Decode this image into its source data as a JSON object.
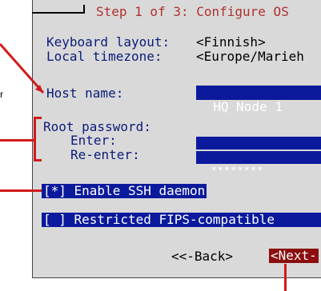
{
  "window_title": "Step 1 of 3: Configure OS",
  "keyboard": {
    "label": "Keyboard layout:",
    "value": "<Finnish>"
  },
  "timezone": {
    "label": "Local timezone:",
    "value": "<Europe/Marieh"
  },
  "host": {
    "label": "Host name:",
    "value": "HQ Node 1"
  },
  "root_password": {
    "label": "Root password:",
    "enter_label": "Enter:",
    "enter_value": "********",
    "reenter_label": "Re-enter:",
    "reenter_value": "********"
  },
  "ssh_checkbox": "[*] Enable SSH daemon",
  "fips_checkbox": "[ ] Restricted FIPS-compatible",
  "buttons": {
    "back": "<<-Back>",
    "next": "<Next-"
  },
  "side_fragment": "r",
  "colors": {
    "highlight": "#0b1a9c",
    "next_button": "#8b0d0d",
    "callout": "#d11a1a",
    "title": "#b0312e"
  }
}
